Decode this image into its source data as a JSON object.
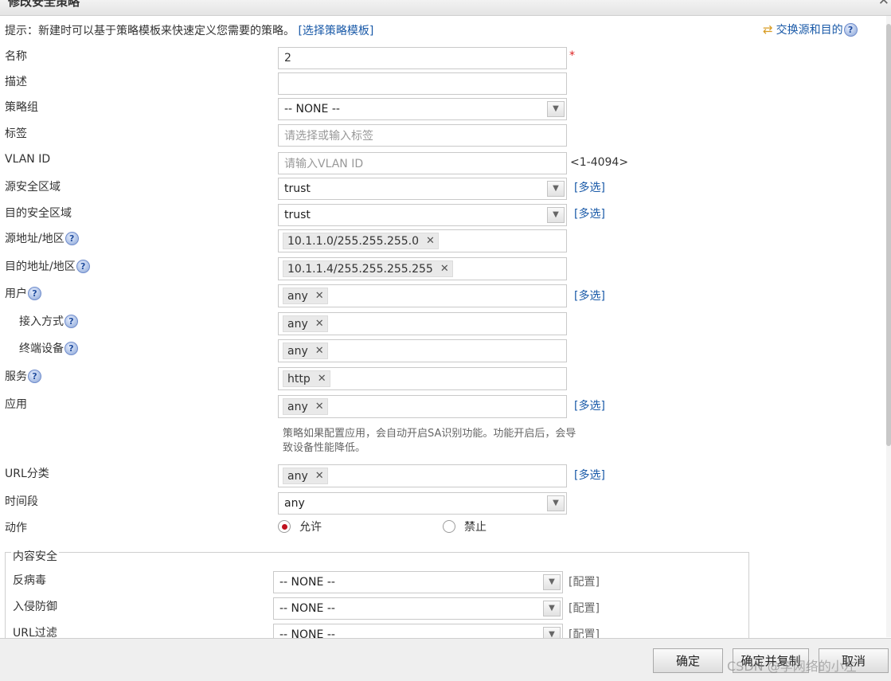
{
  "dialog": {
    "title": "修改安全策略"
  },
  "hint": {
    "text": "提示：新建时可以基于策略模板来快速定义您需要的策略。",
    "link": "[选择策略模板]"
  },
  "swap": {
    "label": "交换源和目的"
  },
  "fields": {
    "name": {
      "label": "名称",
      "value": "2",
      "required_mark": "*"
    },
    "description": {
      "label": "描述",
      "value": ""
    },
    "policy_group": {
      "label": "策略组",
      "value": "-- NONE --"
    },
    "tag": {
      "label": "标签",
      "placeholder": "请选择或输入标签"
    },
    "vlan": {
      "label": "VLAN ID",
      "placeholder": "请输入VLAN ID",
      "range": "<1-4094>"
    },
    "src_zone": {
      "label": "源安全区域",
      "value": "trust",
      "multi": "[多选]"
    },
    "dst_zone": {
      "label": "目的安全区域",
      "value": "trust",
      "multi": "[多选]"
    },
    "src_addr": {
      "label": "源地址/地区",
      "tag": "10.1.1.0/255.255.255.0"
    },
    "dst_addr": {
      "label": "目的地址/地区",
      "tag": "10.1.1.4/255.255.255.255"
    },
    "user": {
      "label": "用户",
      "tag": "any",
      "multi": "[多选]"
    },
    "access_mode": {
      "label": "接入方式",
      "tag": "any"
    },
    "terminal": {
      "label": "终端设备",
      "tag": "any"
    },
    "service": {
      "label": "服务",
      "tag": "http"
    },
    "application": {
      "label": "应用",
      "tag": "any",
      "multi": "[多选]",
      "note": "策略如果配置应用，会自动开启SA识别功能。功能开启后，会导致设备性能降低。"
    },
    "url_category": {
      "label": "URL分类",
      "tag": "any",
      "multi": "[多选]"
    },
    "time_range": {
      "label": "时间段",
      "value": "any"
    },
    "action": {
      "label": "动作",
      "options": [
        "允许",
        "禁止"
      ],
      "selected": "允许"
    }
  },
  "content_security": {
    "legend": "内容安全",
    "antivirus": {
      "label": "反病毒",
      "value": "-- NONE --",
      "config": "[配置]"
    },
    "ips": {
      "label": "入侵防御",
      "value": "-- NONE --",
      "config": "[配置]"
    },
    "url_filter": {
      "label": "URL过滤",
      "value": "-- NONE --",
      "config": "[配置]"
    }
  },
  "footer": {
    "ok": "确定",
    "ok_copy": "确定并复制",
    "cancel": "取消",
    "watermark": "CSDN @李网络的小左"
  },
  "colors": {
    "link": "#1a5aa8",
    "required": "#d22222",
    "radio_selected": "#c0121f"
  }
}
